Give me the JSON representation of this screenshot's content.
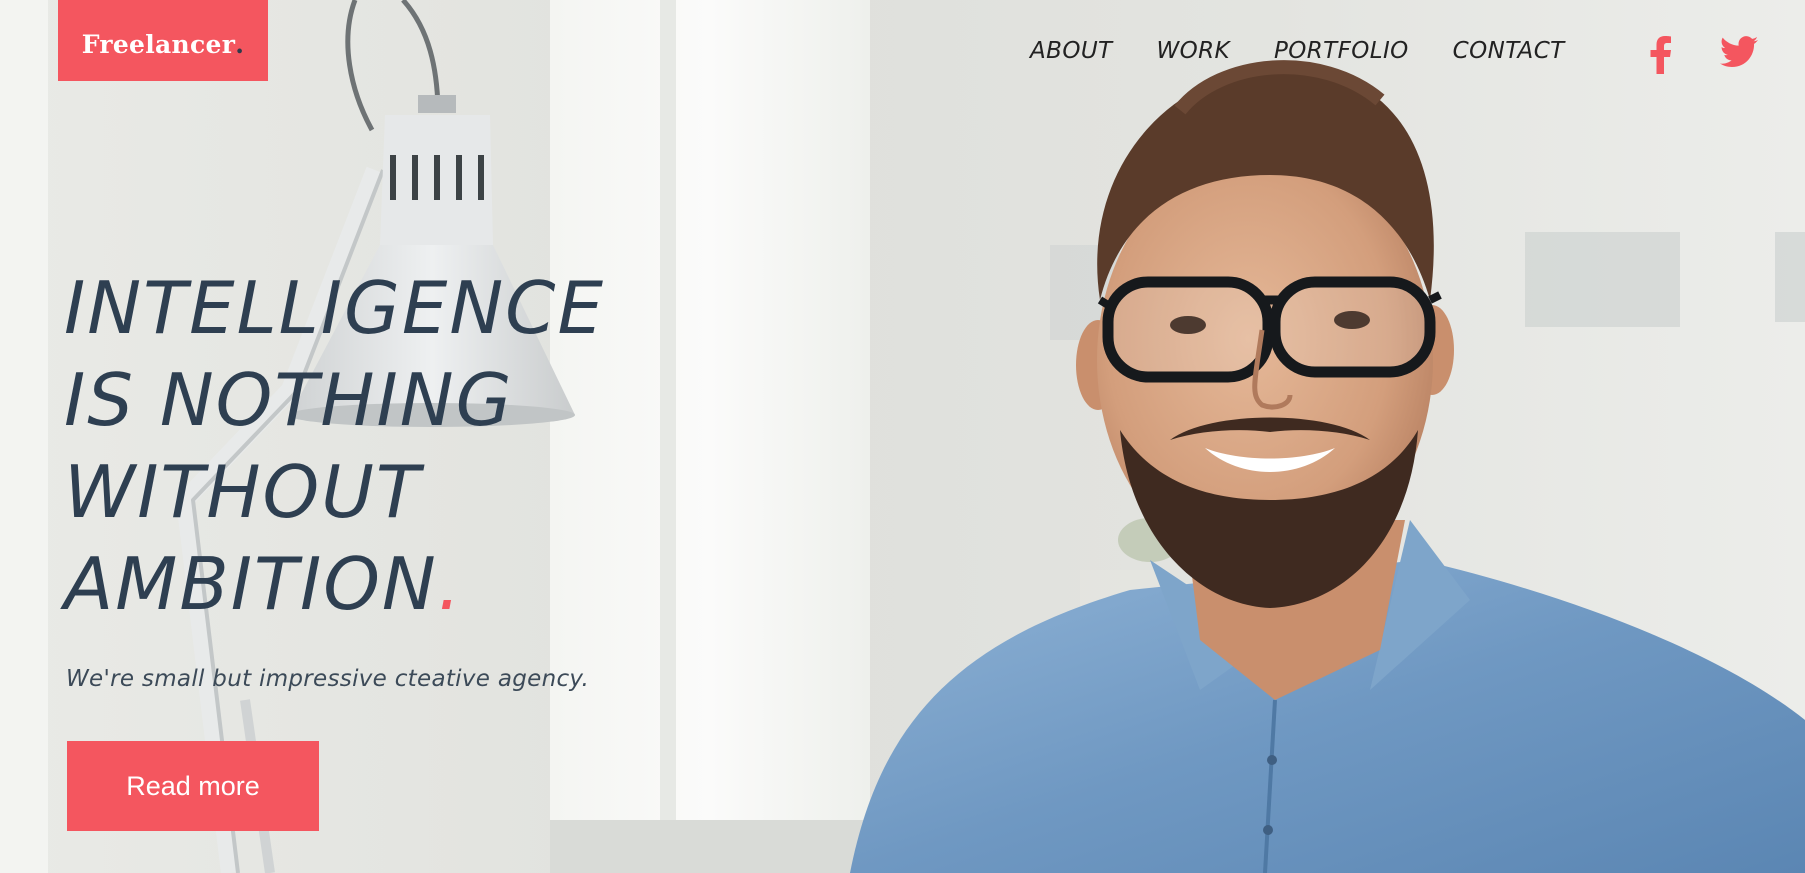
{
  "brand": {
    "name": "Freelancer",
    "dot": ".",
    "accent_color": "#f4565f",
    "dark_color": "#2e3f51"
  },
  "nav": {
    "items": [
      {
        "label": "ABOUT"
      },
      {
        "label": "WORK"
      },
      {
        "label": "PORTFOLIO"
      },
      {
        "label": "CONTACT"
      }
    ]
  },
  "social": {
    "facebook_icon": "facebook-icon",
    "twitter_icon": "twitter-icon"
  },
  "hero": {
    "headline_lines": [
      "INTELLIGENCE",
      "IS NOTHING",
      "WITHOUT",
      "AMBITION"
    ],
    "headline_dot": ".",
    "tagline": "We're small but impressive ctеative agency.",
    "cta_label": "Read more"
  }
}
